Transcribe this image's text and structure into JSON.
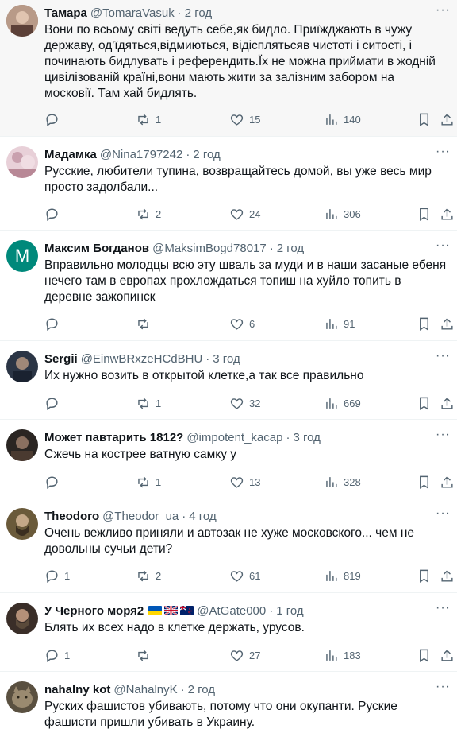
{
  "tweets": [
    {
      "name": "Тамара",
      "handle": "@TomaraVasuk",
      "time": "2 год",
      "text": "Вони по всьому світі ведуть себе,як бидло. Приїжджають в чужу державу, од'їдяться,відмиються, відісплятьсяв чистоті і ситості, і починають бидлувать і референдить.Їх не можна приймати в жодній цивілізованій країні,вони мають жити за залізним забором на московії. Там хай бидлять.",
      "replies": "",
      "reposts": "1",
      "likes": "15",
      "views": "140",
      "avatar_color": "#8a6a5a"
    },
    {
      "name": "Мадамка",
      "handle": "@Nina1797242",
      "time": "2 год",
      "text": "Русские, любители тупина, возвращайтесь домой, вы уже весь мир просто задолбали...",
      "replies": "",
      "reposts": "2",
      "likes": "24",
      "views": "306",
      "avatar_color": "#d9b8c2"
    },
    {
      "name": "Максим Богданов",
      "handle": "@MaksimBogd78017",
      "time": "2 год",
      "text": "Вправильно молодцы всю эту шваль за муди и в наши засаные ебеня нечего там в европах прохлождаться топиш на хуйло топить в деревне зажопинск",
      "replies": "",
      "reposts": "",
      "likes": "6",
      "views": "91",
      "avatar_color": "#00897b",
      "avatar_letter": "M"
    },
    {
      "name": "Sergii",
      "handle": "@EinwBRxzeHCdBHU",
      "time": "3 год",
      "text": "Их нужно возить в открытой клетке,а так все правильно",
      "replies": "",
      "reposts": "1",
      "likes": "32",
      "views": "669",
      "avatar_color": "#2b3545"
    },
    {
      "name": "Может павтарить 1812?",
      "handle": "@impotent_kacap",
      "time": "3 год",
      "text": "Сжечь на кострее ватную самку у",
      "replies": "",
      "reposts": "1",
      "likes": "13",
      "views": "328",
      "avatar_color": "#3a3430"
    },
    {
      "name": "Theodoro",
      "handle": "@Theodor_ua",
      "time": "4 год",
      "text": "Очень вежливо приняли и автозак не хуже московского... чем не довольны сучьи дети?",
      "replies": "1",
      "reposts": "2",
      "likes": "61",
      "views": "819",
      "avatar_color": "#5a4a2a"
    },
    {
      "name": "У Черного моря2",
      "handle": "@AtGate000",
      "time": "1 год",
      "text": "Блять их всех надо в клетке держать, урусов.",
      "replies": "1",
      "reposts": "",
      "likes": "27",
      "views": "183",
      "avatar_color": "#3a2e28",
      "flags": [
        "ukraine-flag",
        "uk-flag",
        "new-zealand-flag"
      ]
    },
    {
      "name": "nahalny kot",
      "handle": "@NahalnyK",
      "time": "2 год",
      "text": "Руских фашистов убивають, потому что они окупанти. Руские фашисти пришли убивать в Украину.",
      "avatar_color": "#7a6a55"
    }
  ],
  "icons": {
    "more": "more-horizontal-icon",
    "reply": "reply-icon",
    "repost": "repost-icon",
    "like": "heart-icon",
    "views": "views-chart-icon",
    "bookmark": "bookmark-icon",
    "share": "share-icon"
  },
  "colors": {
    "text": "#0f1419",
    "secondary": "#536471",
    "divider": "#eff3f4",
    "highlight_bg": "#f7f7f7"
  }
}
